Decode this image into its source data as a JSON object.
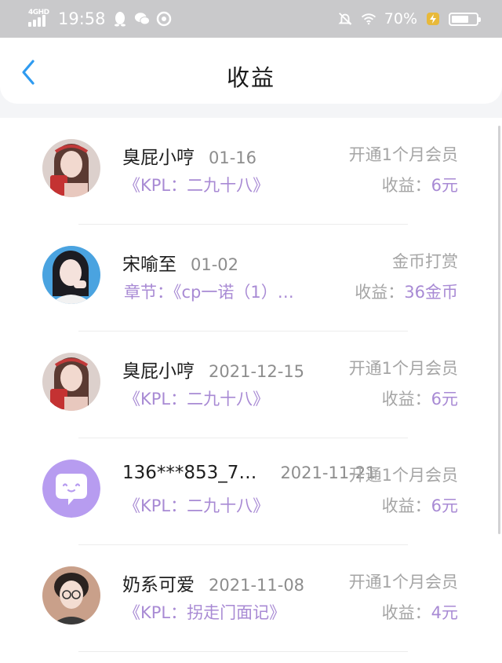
{
  "status_bar": {
    "network": "4GHD",
    "time": "19:58",
    "battery_percent": "70%",
    "battery_level": 0.7
  },
  "header": {
    "title": "收益"
  },
  "earnings": [
    {
      "user": "臭屁小哼",
      "date": "01-16",
      "type": "开通1个月会员",
      "source": "《KPL：二九十八》",
      "earning_label": "收益：",
      "earning_value": "6元",
      "avatar": "girl-red-cup"
    },
    {
      "user": "宋喻至",
      "date": "01-02",
      "type": "金币打赏",
      "source": "章节：《cp一诺（1）…",
      "earning_label": "收益：",
      "earning_value": "36金币",
      "avatar": "girl-blue"
    },
    {
      "user": "臭屁小哼",
      "date": "2021-12-15",
      "type": "开通1个月会员",
      "source": "《KPL：二九十八》",
      "earning_label": "收益：",
      "earning_value": "6元",
      "avatar": "girl-red-cup"
    },
    {
      "user": "136***853_7…",
      "date": "2021-11-21",
      "type": "开通1个月会员",
      "source": "《KPL：二九十八》",
      "earning_label": "收益：",
      "earning_value": "6元",
      "avatar": "default-chat-bubble"
    },
    {
      "user": "奶系可爱",
      "date": "2021-11-08",
      "type": "开通1个月会员",
      "source": "《KPL：拐走门面记》",
      "earning_label": "收益：",
      "earning_value": "4元",
      "avatar": "boy-glasses"
    }
  ],
  "colors": {
    "accent_purple": "#a88ad4",
    "back_blue": "#2f9bf0",
    "status_bar": "#c9c9cb"
  }
}
